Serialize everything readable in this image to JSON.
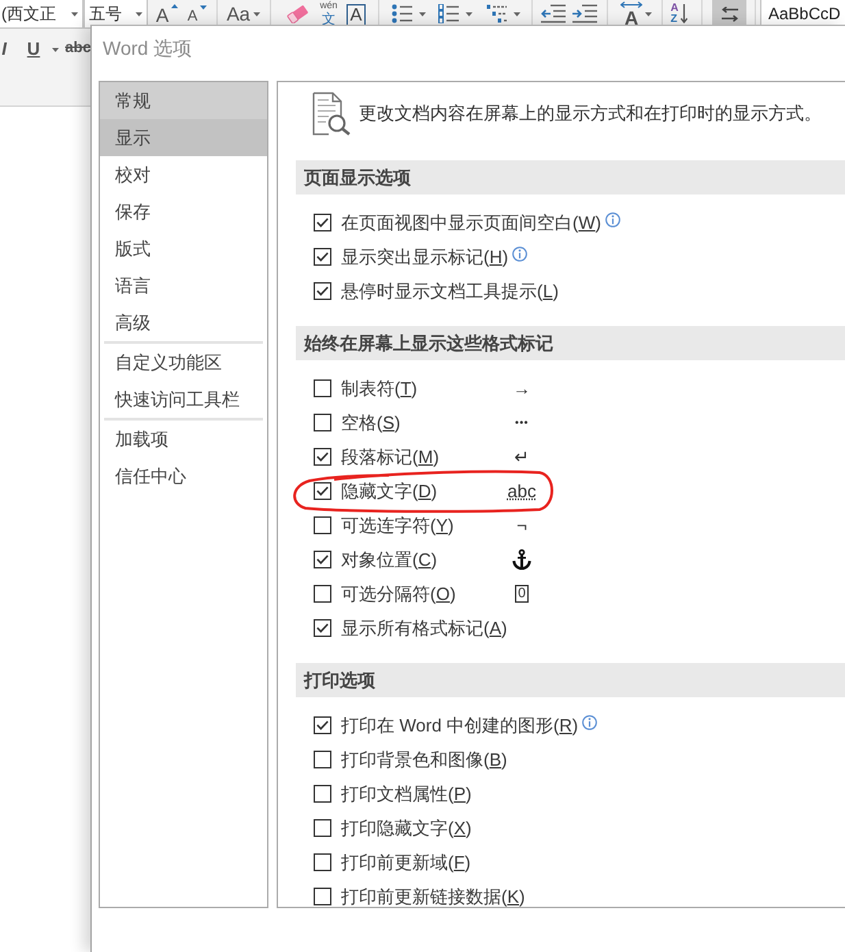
{
  "ribbon": {
    "font_name": "(西文正",
    "font_size": "五号",
    "grow_font": "A",
    "shrink_font": "A",
    "change_case": "Aa",
    "phonetic_guide": {
      "reading": "wén",
      "character": "文"
    },
    "character_border": "A",
    "asian_layout": "A",
    "sort": {
      "top": "A",
      "bottom": "Z"
    },
    "show_marks": {
      "pressed": true
    },
    "style_preview": "AaBbCcD",
    "italic": "I",
    "underline": "U",
    "strikethrough": "abc"
  },
  "dialog": {
    "title": "Word 选项",
    "sidebar": {
      "groups": [
        {
          "items": [
            {
              "label": "常规",
              "selected": false,
              "hovered": true
            },
            {
              "label": "显示",
              "selected": true,
              "hovered": false
            },
            {
              "label": "校对",
              "selected": false,
              "hovered": false
            },
            {
              "label": "保存",
              "selected": false,
              "hovered": false
            },
            {
              "label": "版式",
              "selected": false,
              "hovered": false
            },
            {
              "label": "语言",
              "selected": false,
              "hovered": false
            },
            {
              "label": "高级",
              "selected": false,
              "hovered": false
            }
          ]
        },
        {
          "items": [
            {
              "label": "自定义功能区",
              "selected": false,
              "hovered": false
            },
            {
              "label": "快速访问工具栏",
              "selected": false,
              "hovered": false
            }
          ]
        },
        {
          "items": [
            {
              "label": "加载项",
              "selected": false,
              "hovered": false
            },
            {
              "label": "信任中心",
              "selected": false,
              "hovered": false
            }
          ]
        }
      ]
    },
    "panel": {
      "intro": "更改文档内容在屏幕上的显示方式和在打印时的显示方式。",
      "sections": [
        {
          "title": "页面显示选项",
          "options": [
            {
              "label": "在页面视图中显示页面间空白(W)",
              "checked": true,
              "info": true
            },
            {
              "label": "显示突出显示标记(H)",
              "checked": true,
              "info": true
            },
            {
              "label": "悬停时显示文档工具提示(L)",
              "checked": true,
              "info": false
            }
          ]
        },
        {
          "title": "始终在屏幕上显示这些格式标记",
          "options": [
            {
              "label": "制表符(T)",
              "checked": false,
              "circled": false,
              "mark": {
                "kind": "glyph",
                "text": "→"
              }
            },
            {
              "label": "空格(S)",
              "checked": false,
              "circled": false,
              "mark": {
                "kind": "glyph",
                "text": "•••"
              }
            },
            {
              "label": "段落标记(M)",
              "checked": true,
              "circled": false,
              "mark": {
                "kind": "glyph",
                "text": "↵"
              }
            },
            {
              "label": "隐藏文字(D)",
              "checked": true,
              "circled": true,
              "mark": {
                "kind": "glyph",
                "text": "abc",
                "dotted_underline": true
              }
            },
            {
              "label": "可选连字符(Y)",
              "checked": false,
              "circled": false,
              "mark": {
                "kind": "glyph",
                "text": "¬"
              }
            },
            {
              "label": "对象位置(C)",
              "checked": true,
              "circled": false,
              "mark": {
                "kind": "icon"
              }
            },
            {
              "label": "可选分隔符(O)",
              "checked": false,
              "circled": false,
              "mark": {
                "kind": "glyph",
                "text": "0",
                "boxed": true
              }
            },
            {
              "label": "显示所有格式标记(A)",
              "checked": true,
              "circled": false
            }
          ]
        },
        {
          "title": "打印选项",
          "options": [
            {
              "label": "打印在 Word 中创建的图形(R)",
              "checked": true,
              "info": true
            },
            {
              "label": "打印背景色和图像(B)",
              "checked": false,
              "info": false
            },
            {
              "label": "打印文档属性(P)",
              "checked": false,
              "info": false
            },
            {
              "label": "打印隐藏文字(X)",
              "checked": false,
              "info": false
            },
            {
              "label": "打印前更新域(F)",
              "checked": false,
              "info": false
            },
            {
              "label": "打印前更新链接数据(K)",
              "checked": false,
              "info": false
            }
          ]
        }
      ]
    }
  }
}
